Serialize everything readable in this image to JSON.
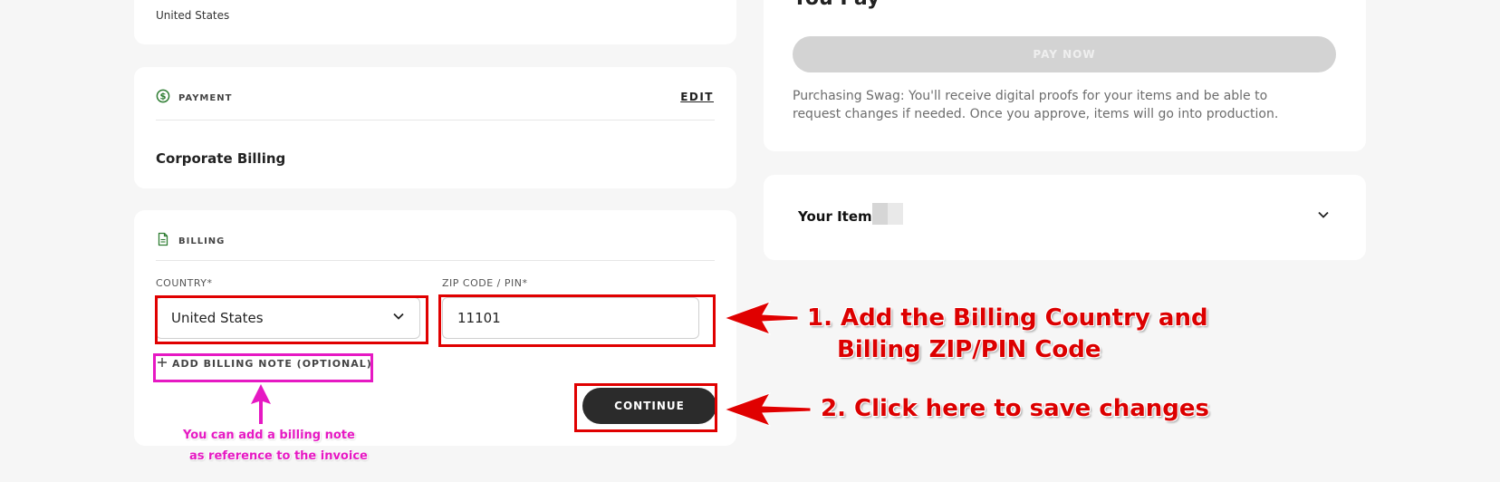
{
  "address": {
    "country_line": "United States"
  },
  "payment": {
    "title": "PAYMENT",
    "edit_label": "EDIT",
    "method": "Corporate Billing"
  },
  "billing": {
    "title": "BILLING",
    "country_label": "COUNTRY*",
    "country_value": "United States",
    "zip_label": "ZIP CODE / PIN*",
    "zip_value": "11101",
    "add_note_label": "ADD BILLING NOTE (OPTIONAL)",
    "continue_label": "CONTINUE"
  },
  "summary": {
    "title": "You Pay",
    "pay_now_label": "PAY NOW",
    "note": "Purchasing Swag: You'll receive digital proofs for your items and be able to request changes if needed. Once you approve, items will go into production."
  },
  "items": {
    "label": "Your Items"
  },
  "annotations": {
    "step1_line1": "1. Add the Billing Country and",
    "step1_line2": "Billing ZIP/PIN Code",
    "step2": "2. Click here to save changes",
    "note_line1": "You can add a billing note",
    "note_line2": "as reference to the invoice"
  },
  "colors": {
    "annotation_red": "#e00000",
    "annotation_magenta": "#e619c3",
    "payment_icon_green": "#2e7d32",
    "continue_button": "#2b2b2b",
    "pay_now_disabled": "#d3d3d3"
  },
  "icons": {
    "payment": "dollar-circle-icon",
    "billing": "document-icon",
    "select": "chevron-down-icon",
    "add_note": "plus-icon",
    "items_toggle": "chevron-down-icon"
  }
}
